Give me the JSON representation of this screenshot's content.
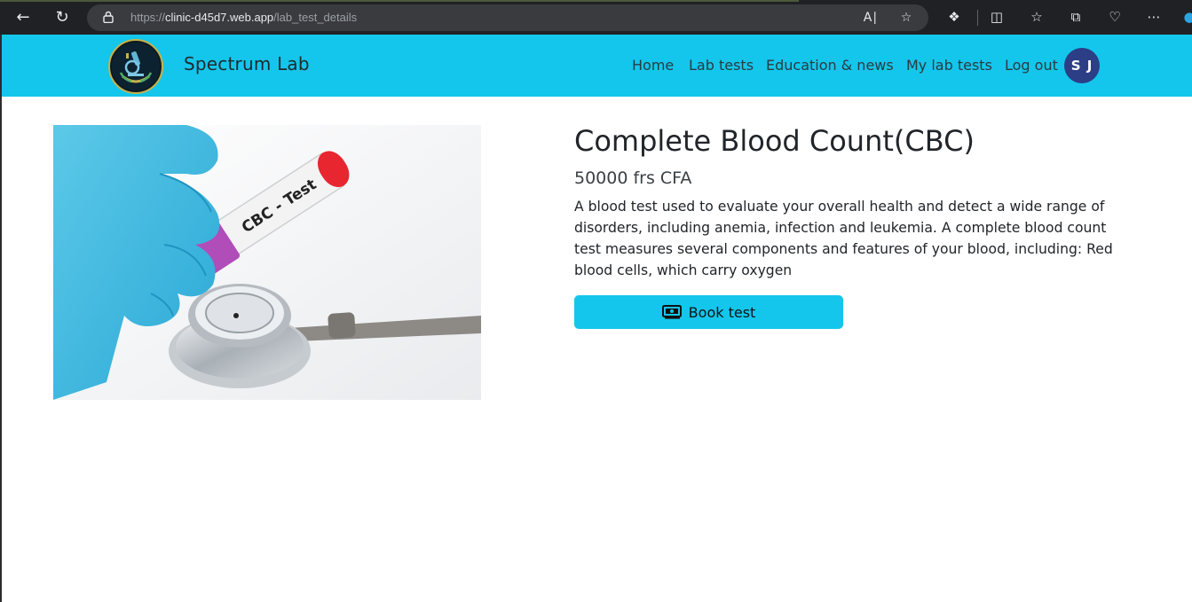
{
  "browser": {
    "url_prefix": "https://",
    "url_domain": "clinic-d45d7.web.app",
    "url_path": "/lab_test_details"
  },
  "header": {
    "brand": "Spectrum Lab",
    "nav": [
      "Home",
      "Lab tests",
      "Education & news",
      "My lab tests",
      "Log out"
    ],
    "avatar_initials": "S J",
    "accent_color": "#14c6ec"
  },
  "hero": {
    "tube_label": "CBC - Test"
  },
  "test": {
    "title": "Complete Blood Count(CBC)",
    "price": "50000 frs CFA",
    "description": "A blood test used to evaluate your overall health and detect a wide range of disorders, including anemia, infection and leukemia. A complete blood count test measures several components and features of your blood, including: Red blood cells, which carry oxygen",
    "book_label": "Book test"
  }
}
